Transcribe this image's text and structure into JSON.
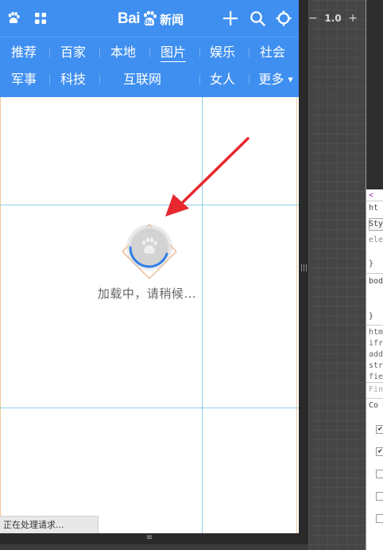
{
  "header": {
    "logo_bai": "Bai",
    "logo_du": "du",
    "logo_suffix": "新闻"
  },
  "nav": {
    "row1": [
      "推荐",
      "百家",
      "本地",
      "图片",
      "娱乐",
      "社会"
    ],
    "row2": [
      "军事",
      "科技",
      "互联网",
      "女人",
      "更多"
    ],
    "active": "图片"
  },
  "content": {
    "loading_text": "加载中，请稍候..."
  },
  "status": {
    "text": "正在处理请求..."
  },
  "emulator": {
    "zoom_value": "1.0",
    "zoom_minus": "−",
    "zoom_plus": "+"
  },
  "devtools": {
    "lines": [
      "ht",
      "Sty",
      "ele",
      "}",
      "bod",
      "}",
      "htm",
      "ifr",
      "add",
      "str",
      "fie",
      "Fin",
      "Co"
    ]
  },
  "icons": {
    "paw": "paw-icon",
    "grid": "grid-icon",
    "plus": "plus-icon",
    "search": "search-icon",
    "settings": "settings-icon",
    "more": "chevron-down-icon"
  },
  "colors": {
    "header_bg": "#3f8ff0",
    "guide": "#8fcfe8",
    "arrow": "#e8282f",
    "spinner_ring": "#2f7fe8"
  }
}
